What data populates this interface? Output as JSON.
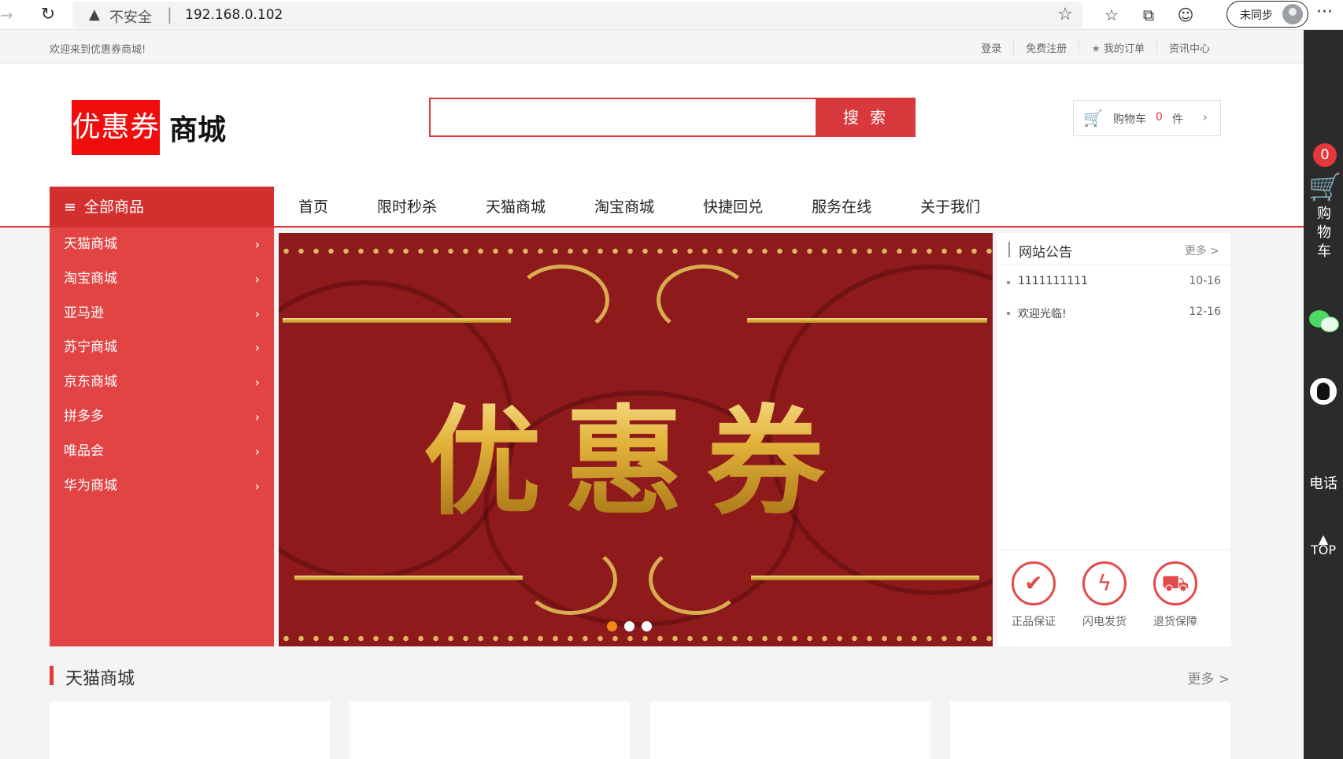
{
  "browser": {
    "insecure_label": "不安全",
    "separator": "|",
    "url": "192.168.0.102",
    "sync_label": "未同步"
  },
  "topbar": {
    "welcome": "欢迎来到优惠券商城!",
    "links": [
      "登录",
      "免费注册",
      "我的订单",
      "资讯中心"
    ]
  },
  "header": {
    "logo_red_text": "优惠券",
    "logo_text": "商城",
    "search_placeholder": "",
    "search_button": "搜 索",
    "cart_label": "购物车",
    "cart_count": "0",
    "cart_unit": "件"
  },
  "nav": {
    "all_goods": "全部商品",
    "items": [
      "首页",
      "限时秒杀",
      "天猫商城",
      "淘宝商城",
      "快捷回兑",
      "服务在线",
      "关于我们"
    ]
  },
  "categories": [
    "天猫商城",
    "淘宝商城",
    "亚马逊",
    "苏宁商城",
    "京东商城",
    "拼多多",
    "唯品会",
    "华为商城"
  ],
  "banner": {
    "text": "优惠券",
    "slide_count": 3,
    "active_slide": 1
  },
  "notice": {
    "title": "网站公告",
    "more": "更多 >",
    "items": [
      {
        "text": "1111111111",
        "date": "10-16"
      },
      {
        "text": "欢迎光临!",
        "date": "12-16"
      }
    ],
    "guarantees": [
      {
        "icon": "shield-check-icon",
        "label": "正品保证"
      },
      {
        "icon": "lightning-icon",
        "label": "闪电发货"
      },
      {
        "icon": "truck-icon",
        "label": "退货保障"
      }
    ]
  },
  "section": {
    "title": "天猫商城",
    "more": "更多 >"
  },
  "right_bar": {
    "cart_badge": "0",
    "cart_text": "购物车",
    "phone": "电话",
    "top": "TOP"
  },
  "colors": {
    "brand_red": "#d8393c",
    "sidebar_red": "#e24444",
    "banner_red": "#8e1a1c",
    "right_bar": "#2b2b2b"
  }
}
